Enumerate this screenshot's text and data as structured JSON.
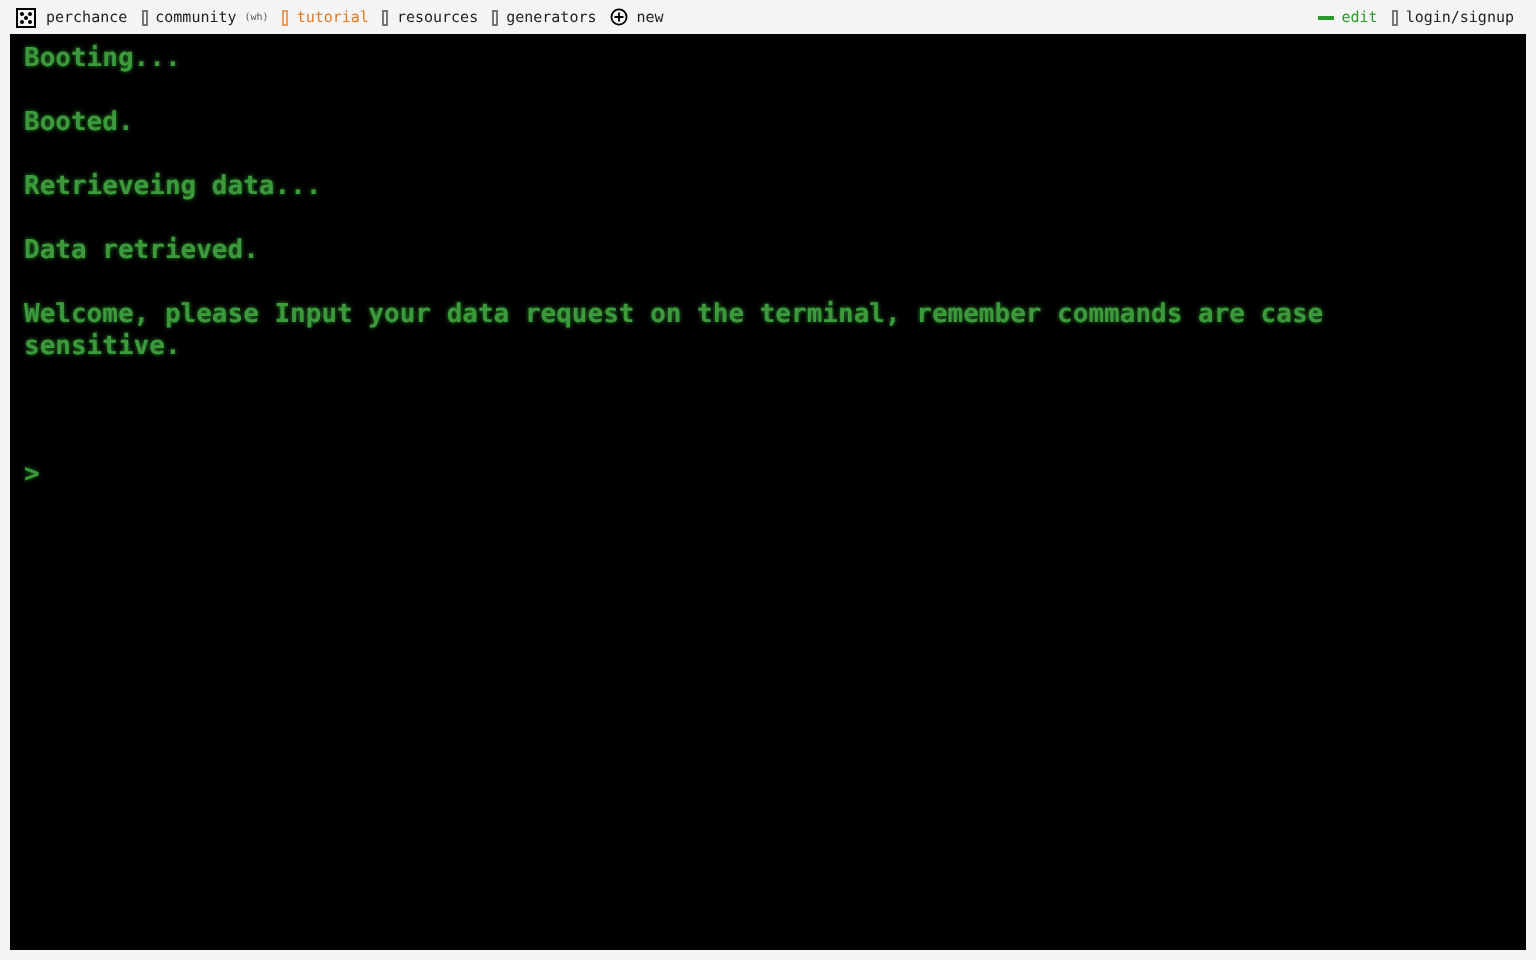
{
  "nav": {
    "logo": "perchance",
    "links": [
      {
        "label": "community",
        "badge": "(wh)",
        "selected": false
      },
      {
        "label": "tutorial",
        "selected": true
      },
      {
        "label": "resources",
        "selected": false
      },
      {
        "label": "generators",
        "selected": false
      },
      {
        "label": "new",
        "selected": false,
        "kind": "new"
      }
    ],
    "right": [
      {
        "label": "edit",
        "kind": "edit"
      },
      {
        "label": "login/signup",
        "kind": "login"
      }
    ]
  },
  "terminal": {
    "lines": [
      "Booting...",
      "Booted.",
      "Retrieveing data...",
      "Data retrieved.",
      "Welcome, please Input your data request on the terminal, remember commands are case sensitive."
    ],
    "prompt": ">"
  }
}
